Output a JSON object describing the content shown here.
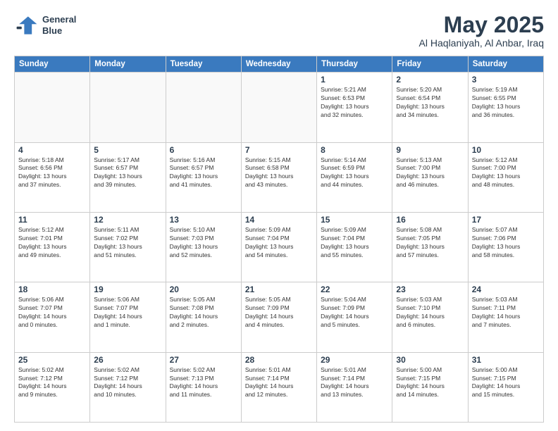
{
  "header": {
    "logo_line1": "General",
    "logo_line2": "Blue",
    "title": "May 2025",
    "location": "Al Haqlaniyah, Al Anbar, Iraq"
  },
  "weekdays": [
    "Sunday",
    "Monday",
    "Tuesday",
    "Wednesday",
    "Thursday",
    "Friday",
    "Saturday"
  ],
  "weeks": [
    [
      {
        "day": "",
        "info": ""
      },
      {
        "day": "",
        "info": ""
      },
      {
        "day": "",
        "info": ""
      },
      {
        "day": "",
        "info": ""
      },
      {
        "day": "1",
        "info": "Sunrise: 5:21 AM\nSunset: 6:53 PM\nDaylight: 13 hours\nand 32 minutes."
      },
      {
        "day": "2",
        "info": "Sunrise: 5:20 AM\nSunset: 6:54 PM\nDaylight: 13 hours\nand 34 minutes."
      },
      {
        "day": "3",
        "info": "Sunrise: 5:19 AM\nSunset: 6:55 PM\nDaylight: 13 hours\nand 36 minutes."
      }
    ],
    [
      {
        "day": "4",
        "info": "Sunrise: 5:18 AM\nSunset: 6:56 PM\nDaylight: 13 hours\nand 37 minutes."
      },
      {
        "day": "5",
        "info": "Sunrise: 5:17 AM\nSunset: 6:57 PM\nDaylight: 13 hours\nand 39 minutes."
      },
      {
        "day": "6",
        "info": "Sunrise: 5:16 AM\nSunset: 6:57 PM\nDaylight: 13 hours\nand 41 minutes."
      },
      {
        "day": "7",
        "info": "Sunrise: 5:15 AM\nSunset: 6:58 PM\nDaylight: 13 hours\nand 43 minutes."
      },
      {
        "day": "8",
        "info": "Sunrise: 5:14 AM\nSunset: 6:59 PM\nDaylight: 13 hours\nand 44 minutes."
      },
      {
        "day": "9",
        "info": "Sunrise: 5:13 AM\nSunset: 7:00 PM\nDaylight: 13 hours\nand 46 minutes."
      },
      {
        "day": "10",
        "info": "Sunrise: 5:12 AM\nSunset: 7:00 PM\nDaylight: 13 hours\nand 48 minutes."
      }
    ],
    [
      {
        "day": "11",
        "info": "Sunrise: 5:12 AM\nSunset: 7:01 PM\nDaylight: 13 hours\nand 49 minutes."
      },
      {
        "day": "12",
        "info": "Sunrise: 5:11 AM\nSunset: 7:02 PM\nDaylight: 13 hours\nand 51 minutes."
      },
      {
        "day": "13",
        "info": "Sunrise: 5:10 AM\nSunset: 7:03 PM\nDaylight: 13 hours\nand 52 minutes."
      },
      {
        "day": "14",
        "info": "Sunrise: 5:09 AM\nSunset: 7:04 PM\nDaylight: 13 hours\nand 54 minutes."
      },
      {
        "day": "15",
        "info": "Sunrise: 5:09 AM\nSunset: 7:04 PM\nDaylight: 13 hours\nand 55 minutes."
      },
      {
        "day": "16",
        "info": "Sunrise: 5:08 AM\nSunset: 7:05 PM\nDaylight: 13 hours\nand 57 minutes."
      },
      {
        "day": "17",
        "info": "Sunrise: 5:07 AM\nSunset: 7:06 PM\nDaylight: 13 hours\nand 58 minutes."
      }
    ],
    [
      {
        "day": "18",
        "info": "Sunrise: 5:06 AM\nSunset: 7:07 PM\nDaylight: 14 hours\nand 0 minutes."
      },
      {
        "day": "19",
        "info": "Sunrise: 5:06 AM\nSunset: 7:07 PM\nDaylight: 14 hours\nand 1 minute."
      },
      {
        "day": "20",
        "info": "Sunrise: 5:05 AM\nSunset: 7:08 PM\nDaylight: 14 hours\nand 2 minutes."
      },
      {
        "day": "21",
        "info": "Sunrise: 5:05 AM\nSunset: 7:09 PM\nDaylight: 14 hours\nand 4 minutes."
      },
      {
        "day": "22",
        "info": "Sunrise: 5:04 AM\nSunset: 7:09 PM\nDaylight: 14 hours\nand 5 minutes."
      },
      {
        "day": "23",
        "info": "Sunrise: 5:03 AM\nSunset: 7:10 PM\nDaylight: 14 hours\nand 6 minutes."
      },
      {
        "day": "24",
        "info": "Sunrise: 5:03 AM\nSunset: 7:11 PM\nDaylight: 14 hours\nand 7 minutes."
      }
    ],
    [
      {
        "day": "25",
        "info": "Sunrise: 5:02 AM\nSunset: 7:12 PM\nDaylight: 14 hours\nand 9 minutes."
      },
      {
        "day": "26",
        "info": "Sunrise: 5:02 AM\nSunset: 7:12 PM\nDaylight: 14 hours\nand 10 minutes."
      },
      {
        "day": "27",
        "info": "Sunrise: 5:02 AM\nSunset: 7:13 PM\nDaylight: 14 hours\nand 11 minutes."
      },
      {
        "day": "28",
        "info": "Sunrise: 5:01 AM\nSunset: 7:14 PM\nDaylight: 14 hours\nand 12 minutes."
      },
      {
        "day": "29",
        "info": "Sunrise: 5:01 AM\nSunset: 7:14 PM\nDaylight: 14 hours\nand 13 minutes."
      },
      {
        "day": "30",
        "info": "Sunrise: 5:00 AM\nSunset: 7:15 PM\nDaylight: 14 hours\nand 14 minutes."
      },
      {
        "day": "31",
        "info": "Sunrise: 5:00 AM\nSunset: 7:15 PM\nDaylight: 14 hours\nand 15 minutes."
      }
    ]
  ]
}
